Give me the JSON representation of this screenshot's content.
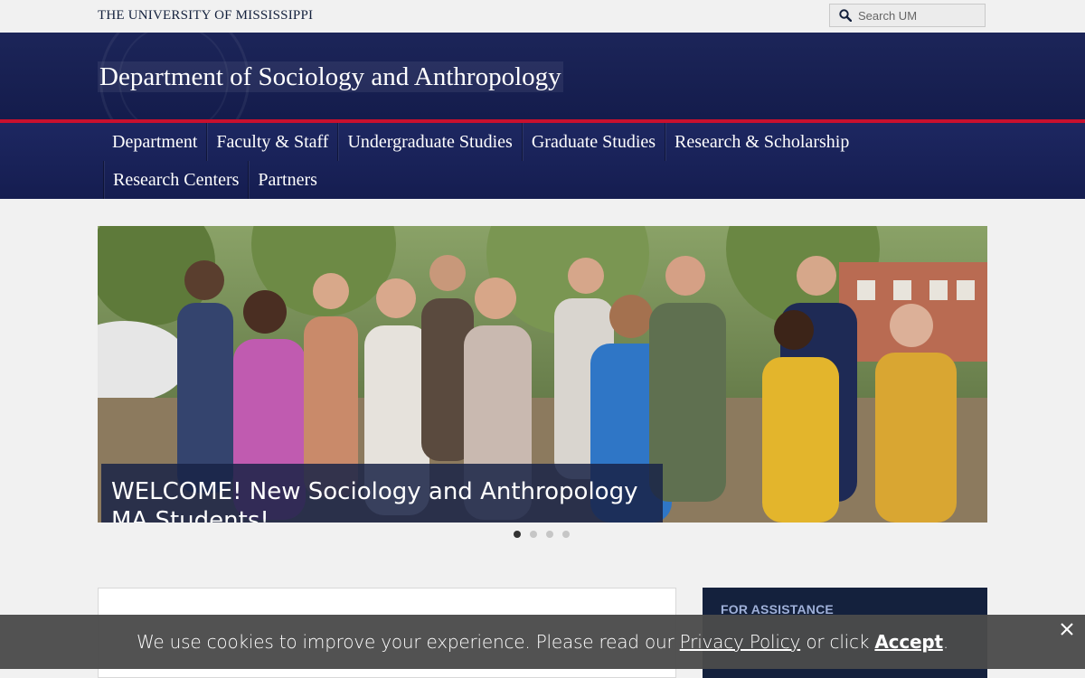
{
  "utility": {
    "university_name": "THE UNIVERSITY OF MISSISSIPPI",
    "search_placeholder": "Search UM"
  },
  "header": {
    "department_title": "Department of Sociology and Anthropology"
  },
  "nav": {
    "row1": [
      "Department",
      "Faculty & Staff",
      "Undergraduate Studies",
      "Graduate Studies",
      "Research & Scholarship"
    ],
    "row2": [
      "Research Centers",
      "Partners"
    ]
  },
  "hero": {
    "caption": "WELCOME! New Sociology and Anthropology MA Students!",
    "slide_count": 4,
    "active_slide": 1
  },
  "sidebar": {
    "assist_title": "FOR ASSISTANCE"
  },
  "cookie": {
    "text_before": "We use cookies to improve your experience. Please read our ",
    "privacy_link": "Privacy Policy",
    "text_middle": " or click ",
    "accept_link": "Accept",
    "text_after": "."
  },
  "colors": {
    "navy": "#1c2559",
    "accent_red": "#c8102e",
    "cookie_bg": "#4b4b4b"
  }
}
